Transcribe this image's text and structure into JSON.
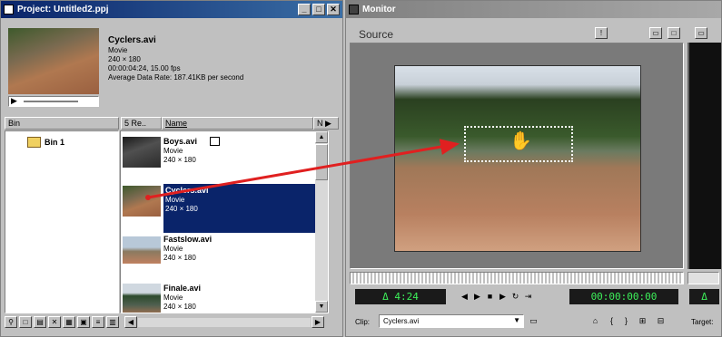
{
  "project": {
    "title": "Project: Untitled2.ppj",
    "preview": {
      "name": "Cyclers.avi",
      "type": "Movie",
      "dims": "240 × 180",
      "duration": "00:00:04:24, 15.00 fps",
      "rate": "Average Data Rate: 187.41KB per second"
    },
    "columns": {
      "bin": "Bin",
      "seq": "5 Re..",
      "name": "Name",
      "notes": "N"
    },
    "bin_label": "Bin 1",
    "clips": [
      {
        "name": "Boys.avi",
        "type": "Movie",
        "dims": "240 × 180"
      },
      {
        "name": "Cyclers.avi",
        "type": "Movie",
        "dims": "240 × 180"
      },
      {
        "name": "Fastslow.avi",
        "type": "Movie",
        "dims": "240 × 180"
      },
      {
        "name": "Finale.avi",
        "type": "Movie",
        "dims": "240 × 180"
      }
    ]
  },
  "monitor": {
    "title": "Monitor",
    "source_label": "Source",
    "duration": "Δ 4:24",
    "timecode": "00:00:00:00",
    "clip_label": "Clip:",
    "clip_value": "Cyclers.avi",
    "target_label": "Target:",
    "right_duration": "Δ"
  },
  "colors": {
    "selection": "#0a246a",
    "arrow": "#e02020",
    "lcd_text": "#3df05a"
  }
}
